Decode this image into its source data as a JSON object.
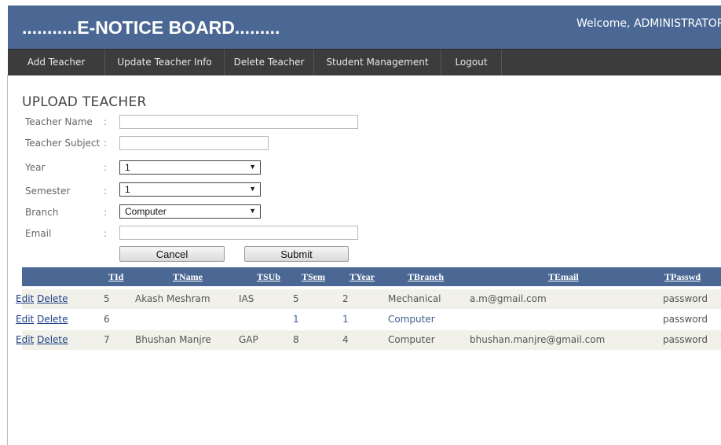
{
  "header": {
    "title": "...........E-NOTICE BOARD.........",
    "welcome": "Welcome, ADMINISTRATOR"
  },
  "nav": {
    "items": [
      "Add Teacher",
      "Update Teacher Info",
      "Delete Teacher",
      "Student Management",
      "Logout"
    ]
  },
  "form": {
    "heading": "UPLOAD TEACHER",
    "colon": ":",
    "labels": {
      "teacher_name": "Teacher Name",
      "teacher_subject": "Teacher Subject",
      "year": "Year",
      "semester": "Semester",
      "branch": "Branch",
      "email": "Email"
    },
    "values": {
      "teacher_name": "",
      "teacher_subject": "",
      "year": "1",
      "semester": "1",
      "branch": "Computer",
      "email": ""
    },
    "cancel_label": "Cancel",
    "submit_label": "Submit"
  },
  "table": {
    "headers": [
      "TId",
      "TName",
      "TSUb",
      "TSem",
      "TYear",
      "TBranch",
      "TEmail",
      "TPasswd"
    ],
    "edit_label": "Edit",
    "delete_label": "Delete",
    "rows": [
      {
        "tid": "5",
        "tname": "Akash Meshram",
        "tsub": "IAS",
        "tsem": "5",
        "tyear": "2",
        "tbranch": "Mechanical",
        "temail": "a.m@gmail.com",
        "tpasswd": "password"
      },
      {
        "tid": "6",
        "tname": "",
        "tsub": "",
        "tsem": "1",
        "tyear": "1",
        "tbranch": "Computer",
        "temail": "",
        "tpasswd": "password"
      },
      {
        "tid": "7",
        "tname": "Bhushan Manjre",
        "tsub": "GAP",
        "tsem": "8",
        "tyear": "4",
        "tbranch": "Computer",
        "temail": "bhushan.manjre@gmail.com",
        "tpasswd": "password"
      }
    ]
  },
  "colors": {
    "header_bg": "#4a6893",
    "nav_bg": "#3c3c3c",
    "alt_row_bg": "#f1f1ea",
    "link": "#1f3f86"
  }
}
